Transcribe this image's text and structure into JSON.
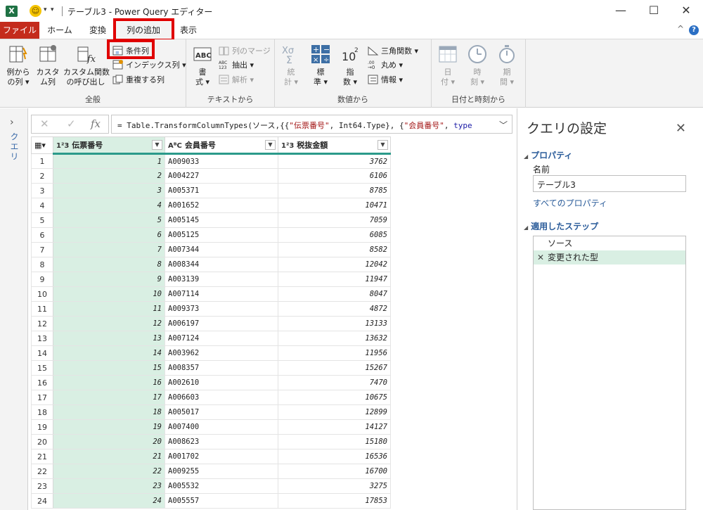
{
  "window": {
    "title": "テーブル3 - Power Query エディター",
    "app_icon": "X",
    "controls": {
      "minimize": "—",
      "maximize": "☐",
      "close": "✕"
    }
  },
  "tabs": [
    {
      "label": "ファイル"
    },
    {
      "label": "ホーム"
    },
    {
      "label": "変換"
    },
    {
      "label": "列の追加"
    },
    {
      "label": "表示"
    }
  ],
  "ribbon": {
    "general": {
      "label": "全般",
      "example_col": "例から\nの列 ▾",
      "custom_col": "カスタ\nム列",
      "invoke_custom": "カスタム関数\nの呼び出し",
      "conditional_col": "条件列",
      "index_col": "インデックス列 ▾",
      "duplicate_col": "重複する列"
    },
    "text": {
      "label": "テキストから",
      "format": "書\n式 ▾",
      "merge_cols": "列のマージ",
      "extract": "抽出 ▾",
      "parse": "解析 ▾"
    },
    "number": {
      "label": "数値から",
      "stats": "統\n計 ▾",
      "standard": "標\n準 ▾",
      "scientific": "指\n数 ▾",
      "trig": "三角関数 ▾",
      "rounding": "丸め ▾",
      "info": "情報 ▾"
    },
    "datetime": {
      "label": "日付と時刻から",
      "date": "日\n付 ▾",
      "time": "時\n刻 ▾",
      "duration": "期\n間 ▾"
    }
  },
  "query_pane": {
    "label": "クエリ"
  },
  "formula": {
    "prefix": "= Table.TransformColumnTypes(ソース,{{",
    "s1": "\"伝票番号\"",
    "mid1": ", Int64.Type}, {",
    "s2": "\"会員番号\"",
    "mid2": ", ",
    "kw": "type"
  },
  "grid": {
    "columns": [
      {
        "type": "1²3",
        "name": "伝票番号"
      },
      {
        "type": "AᴮC",
        "name": "会員番号"
      },
      {
        "type": "1²3",
        "name": "税抜金額"
      }
    ],
    "rows": [
      [
        "1",
        "1",
        "A009033",
        "3762"
      ],
      [
        "2",
        "2",
        "A004227",
        "6106"
      ],
      [
        "3",
        "3",
        "A005371",
        "8785"
      ],
      [
        "4",
        "4",
        "A001652",
        "10471"
      ],
      [
        "5",
        "5",
        "A005145",
        "7059"
      ],
      [
        "6",
        "6",
        "A005125",
        "6085"
      ],
      [
        "7",
        "7",
        "A007344",
        "8582"
      ],
      [
        "8",
        "8",
        "A008344",
        "12042"
      ],
      [
        "9",
        "9",
        "A003139",
        "11947"
      ],
      [
        "10",
        "10",
        "A007114",
        "8047"
      ],
      [
        "11",
        "11",
        "A009373",
        "4872"
      ],
      [
        "12",
        "12",
        "A006197",
        "13133"
      ],
      [
        "13",
        "13",
        "A007124",
        "13632"
      ],
      [
        "14",
        "14",
        "A003962",
        "11956"
      ],
      [
        "15",
        "15",
        "A008357",
        "15267"
      ],
      [
        "16",
        "16",
        "A002610",
        "7470"
      ],
      [
        "17",
        "17",
        "A006603",
        "10675"
      ],
      [
        "18",
        "18",
        "A005017",
        "12899"
      ],
      [
        "19",
        "19",
        "A007400",
        "14127"
      ],
      [
        "20",
        "20",
        "A008623",
        "15180"
      ],
      [
        "21",
        "21",
        "A001702",
        "16536"
      ],
      [
        "22",
        "22",
        "A009255",
        "16700"
      ],
      [
        "23",
        "23",
        "A005532",
        "3275"
      ],
      [
        "24",
        "24",
        "A005557",
        "17853"
      ]
    ]
  },
  "settings": {
    "title": "クエリの設定",
    "properties_label": "プロパティ",
    "name_label": "名前",
    "name_value": "テーブル3",
    "all_props_link": "すべてのプロパティ",
    "steps_label": "適用したステップ",
    "steps": [
      {
        "label": "ソース"
      },
      {
        "label": "変更された型"
      }
    ]
  },
  "colors": {
    "file_tab": "#c42b1c",
    "highlight_box": "#e00000",
    "selected_column": "#d9efe3",
    "accent_link": "#2b5c9a"
  }
}
